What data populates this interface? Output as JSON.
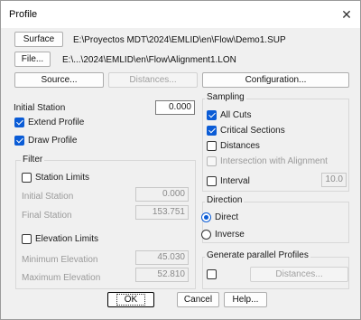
{
  "window": {
    "title": "Profile",
    "close_glyph": "✕"
  },
  "surface": {
    "button_label": "Surface",
    "path": "E:\\Proyectos MDT\\2024\\EMLID\\en\\Flow\\Demo1.SUP"
  },
  "file": {
    "button_label": "File...",
    "path": "E:\\...\\2024\\EMLID\\en\\Flow\\Alignment1.LON"
  },
  "toolbar": {
    "source_label": "Source...",
    "distances_label": "Distances...",
    "configuration_label": "Configuration..."
  },
  "left": {
    "initial_station_label": "Initial Station",
    "initial_station_value": "0.000",
    "extend_profile_label": "Extend Profile",
    "extend_profile_checked": true,
    "draw_profile_label": "Draw Profile",
    "draw_profile_checked": true
  },
  "filter": {
    "title": "Filter",
    "station_limits_label": "Station Limits",
    "station_limits_checked": false,
    "initial_station_label": "Initial Station",
    "initial_station_value": "0.000",
    "final_station_label": "Final Station",
    "final_station_value": "153.751",
    "elevation_limits_label": "Elevation Limits",
    "elevation_limits_checked": false,
    "min_elevation_label": "Minimum Elevation",
    "min_elevation_value": "45.030",
    "max_elevation_label": "Maximum Elevation",
    "max_elevation_value": "52.810"
  },
  "sampling": {
    "title": "Sampling",
    "all_cuts_label": "All Cuts",
    "all_cuts_checked": true,
    "critical_sections_label": "Critical Sections",
    "critical_sections_checked": true,
    "distances_label": "Distances",
    "distances_checked": false,
    "intersection_label": "Intersection with Alignment",
    "interval_label": "Interval",
    "interval_value": "10.0"
  },
  "direction": {
    "title": "Direction",
    "direct_label": "Direct",
    "inverse_label": "Inverse",
    "selected": "Direct"
  },
  "parallel": {
    "title": "Generate parallel Profiles",
    "distances_label": "Distances..."
  },
  "footer": {
    "ok_label": "OK",
    "cancel_label": "Cancel",
    "help_label": "Help..."
  },
  "colors": {
    "accent": "#0b5cd6",
    "background": "#f0f0f0"
  }
}
